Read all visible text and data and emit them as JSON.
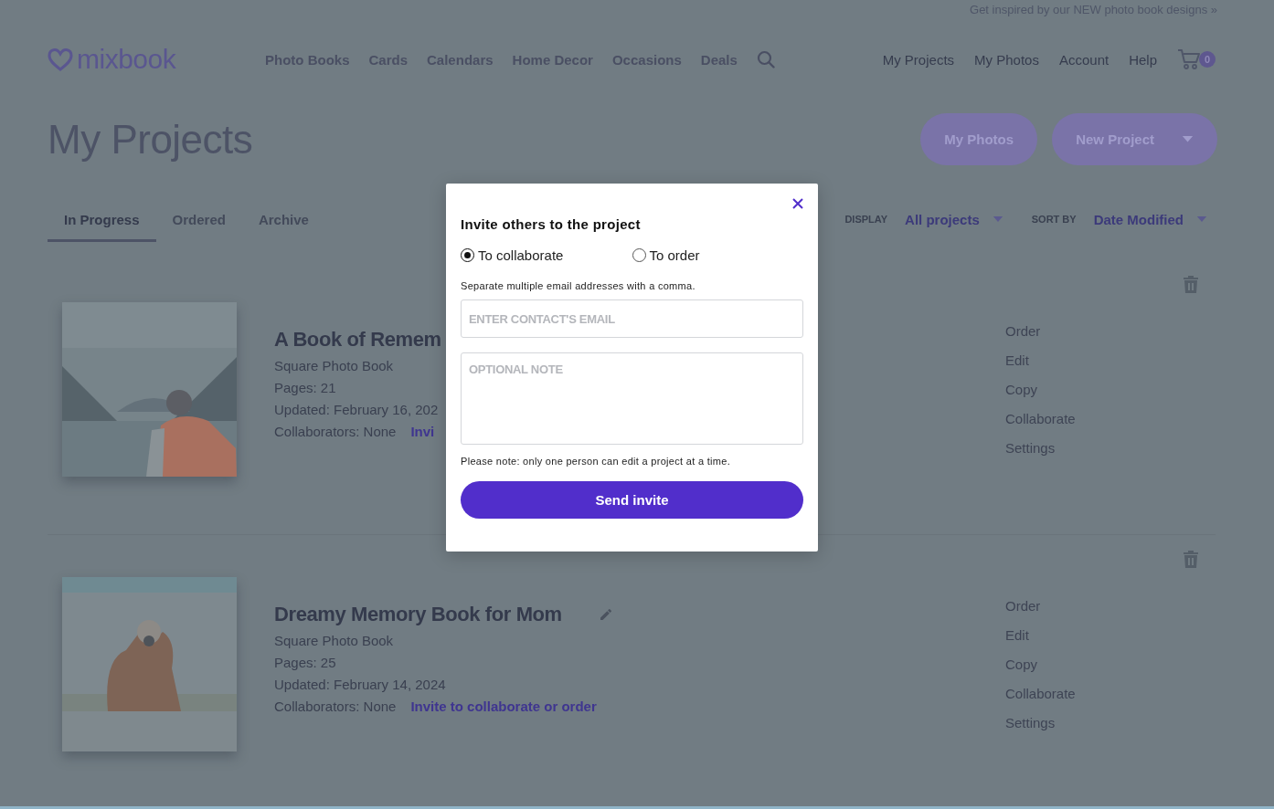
{
  "top_banner": "Get inspired by our NEW photo book designs »",
  "header": {
    "logo": "mixbook",
    "nav": [
      "Photo Books",
      "Cards",
      "Calendars",
      "Home Decor",
      "Occasions",
      "Deals"
    ],
    "account_nav": [
      "My Projects",
      "My Photos",
      "Account",
      "Help"
    ],
    "cart_count": "0"
  },
  "page_title": "My Projects",
  "actions": [
    {
      "label": "My Photos",
      "kind": "plain"
    },
    {
      "label": "New Project",
      "kind": "dropdown"
    }
  ],
  "tabs": [
    {
      "label": "In Progress",
      "selected": true
    },
    {
      "label": "Ordered",
      "selected": false
    },
    {
      "label": "Archive",
      "selected": false
    }
  ],
  "filters": [
    {
      "label": "DISPLAY",
      "value": "All projects"
    },
    {
      "label": "SORT BY",
      "value": "Date Modified"
    }
  ],
  "projects": [
    {
      "title": "A Book of Remem",
      "type": "Square Photo Book",
      "pages": "Pages: 21",
      "updated": "Updated: February 16, 202",
      "collaborators": "Collaborators: None",
      "invite_link": "Invi",
      "show_edit": false,
      "actions": [
        "Order",
        "Edit",
        "Copy",
        "Collaborate",
        "Settings"
      ]
    },
    {
      "title": "Dreamy Memory Book for Mom",
      "type": "Square Photo Book",
      "pages": "Pages: 25",
      "updated": "Updated: February 14, 2024",
      "collaborators": "Collaborators: None",
      "invite_link": "Invite to collaborate or order",
      "show_edit": true,
      "actions": [
        "Order",
        "Edit",
        "Copy",
        "Collaborate",
        "Settings"
      ]
    }
  ],
  "dialog": {
    "title": "Invite others to the project",
    "options": [
      {
        "label": "To collaborate",
        "selected": true
      },
      {
        "label": "To order",
        "selected": false
      }
    ],
    "hint": "Separate multiple email addresses with a comma.",
    "email_placeholder": "ENTER CONTACT'S EMAIL",
    "note_placeholder": "OPTIONAL NOTE",
    "notice": "Please note: only one person can edit a project at a time.",
    "submit": "Send invite"
  }
}
